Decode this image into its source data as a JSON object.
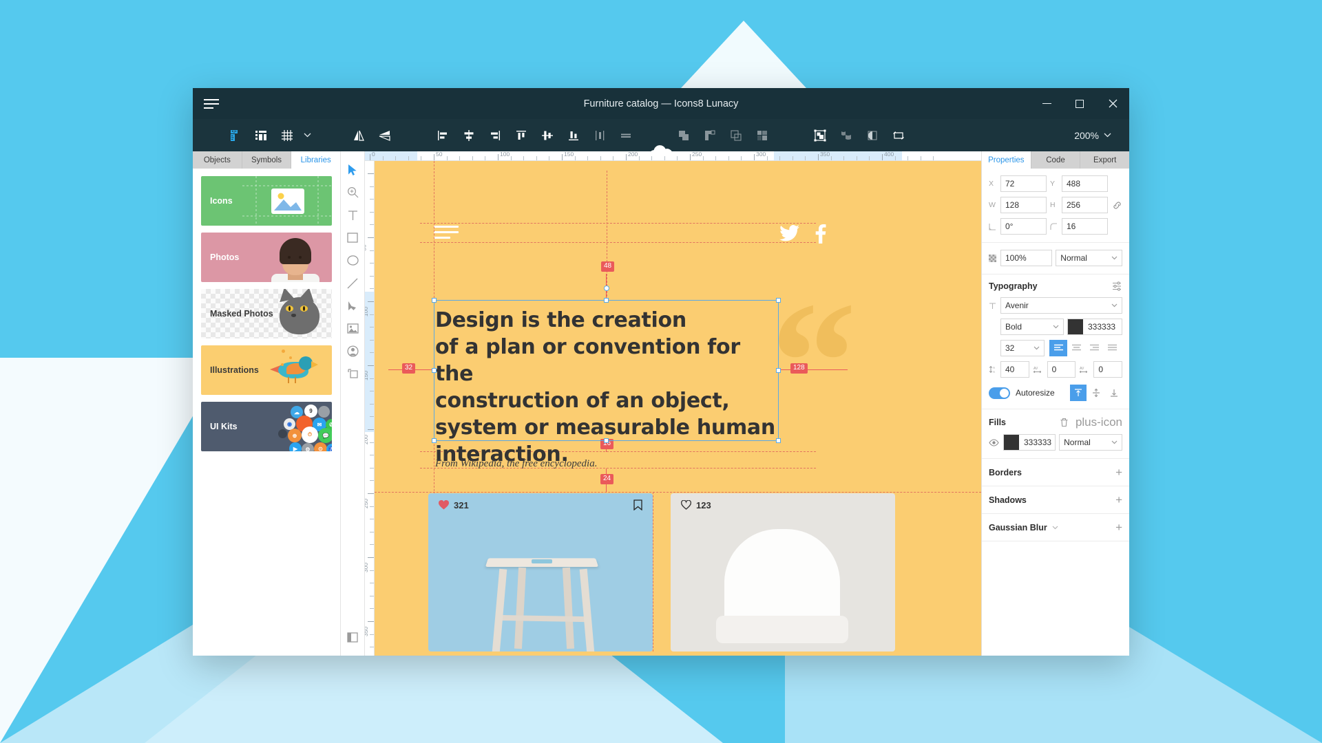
{
  "window": {
    "title": "Furniture catalog — Icons8 Lunacy",
    "controls": {
      "minimize": "minimize-button",
      "maximize": "maximize-button",
      "close": "close-button"
    }
  },
  "toolbar": {
    "zoom_level": "200%",
    "icons": [
      "ruler-icon",
      "layout-grid-icon",
      "grid-icon",
      "chevron-down-icon",
      "flip-horizontal-icon",
      "flip-vertical-icon",
      "align-left-icon",
      "align-center-horizontal-icon",
      "align-right-icon",
      "align-top-icon",
      "align-middle-vertical-icon",
      "align-bottom-icon",
      "distribute-horizontal-icon",
      "distribute-vertical-icon",
      "union-icon",
      "subtract-icon",
      "intersect-icon",
      "difference-icon",
      "mask-icon",
      "flatten-icon",
      "half-fill-icon",
      "rotate-copy-icon"
    ]
  },
  "left_panel": {
    "tabs": [
      {
        "label": "Objects",
        "active": false
      },
      {
        "label": "Symbols",
        "active": false
      },
      {
        "label": "Libraries",
        "active": true
      }
    ],
    "libraries": [
      {
        "label": "Icons",
        "color": "#6cc473"
      },
      {
        "label": "Photos",
        "color": "#dc97a5"
      },
      {
        "label": "Masked Photos",
        "color": "#e8e8e8"
      },
      {
        "label": "Illustrations",
        "color": "#fbce70"
      },
      {
        "label": "UI Kits",
        "color": "#4f5b6e"
      }
    ]
  },
  "tools": [
    "select-tool",
    "zoom-tool",
    "text-tool",
    "rectangle-tool",
    "ellipse-tool",
    "line-tool",
    "pen-tool",
    "image-tool",
    "avatar-tool",
    "artboard-tool",
    "panel-toggle-tool"
  ],
  "canvas": {
    "quote_text": "Design is the creation\nof a plan or convention for the\nconstruction of an object,\nsystem or measurable human\ninteraction.",
    "source_text": "From Wikipedia, the free encyclopedia.",
    "quote_mark": "“",
    "measurements": {
      "top": "48",
      "left": "32",
      "right": "128",
      "bottom": "16",
      "below": "24"
    },
    "ruler_top_labels": [
      "0",
      "50",
      "100",
      "150",
      "200",
      "250",
      "300",
      "350",
      "400"
    ],
    "ruler_left_labels": [
      "0",
      "50",
      "100",
      "150",
      "200",
      "250",
      "300",
      "350"
    ],
    "cards": [
      {
        "likes": "321",
        "liked": true
      },
      {
        "likes": "123",
        "liked": false
      }
    ],
    "social": [
      "twitter-icon",
      "facebook-icon"
    ]
  },
  "right_panel": {
    "tabs": [
      {
        "label": "Properties",
        "active": true
      },
      {
        "label": "Code",
        "active": false
      },
      {
        "label": "Export",
        "active": false
      }
    ],
    "geometry": {
      "x_label": "X",
      "x_value": "72",
      "y_label": "Y",
      "y_value": "488",
      "w_label": "W",
      "w_value": "128",
      "h_label": "H",
      "h_value": "256",
      "rotation_value": "0°",
      "radius_value": "16",
      "link_icon": "link-icon"
    },
    "appearance": {
      "opacity_value": "100%",
      "blend_mode": "Normal"
    },
    "typography": {
      "title": "Typography",
      "settings_icon": "sliders-icon",
      "font_family": "Avenir",
      "font_weight": "Bold",
      "color_hex": "333333",
      "color_value": "#333333",
      "font_size": "32",
      "alignment": [
        "align-left",
        "align-center",
        "align-right",
        "align-justify"
      ],
      "alignment_active": 0,
      "line_height": "40",
      "letter_spacing": "0",
      "paragraph_spacing": "0",
      "autoresize_label": "Autoresize",
      "autoresize_on": true,
      "vertical_align": [
        "valign-top",
        "valign-middle",
        "valign-bottom"
      ],
      "vertical_align_active": 0
    },
    "fills": {
      "title": "Fills",
      "delete_icon": "trash-icon",
      "add_icon": "plus-icon",
      "items": [
        {
          "hex": "333333",
          "color": "#333333",
          "blend": "Normal",
          "visible": true
        }
      ]
    },
    "sections": [
      {
        "title": "Borders",
        "add": "+",
        "has_chevron": false
      },
      {
        "title": "Shadows",
        "add": "+",
        "has_chevron": false
      },
      {
        "title": "Gaussian Blur",
        "add": "+",
        "has_chevron": true
      }
    ]
  },
  "colors": {
    "accent": "#4a9eea",
    "titlebar": "#18313a",
    "toolbar": "#1b343d",
    "canvas_bg": "#fbcd71",
    "badge": "#ea5a5a",
    "desktop": "#55c9ee"
  }
}
